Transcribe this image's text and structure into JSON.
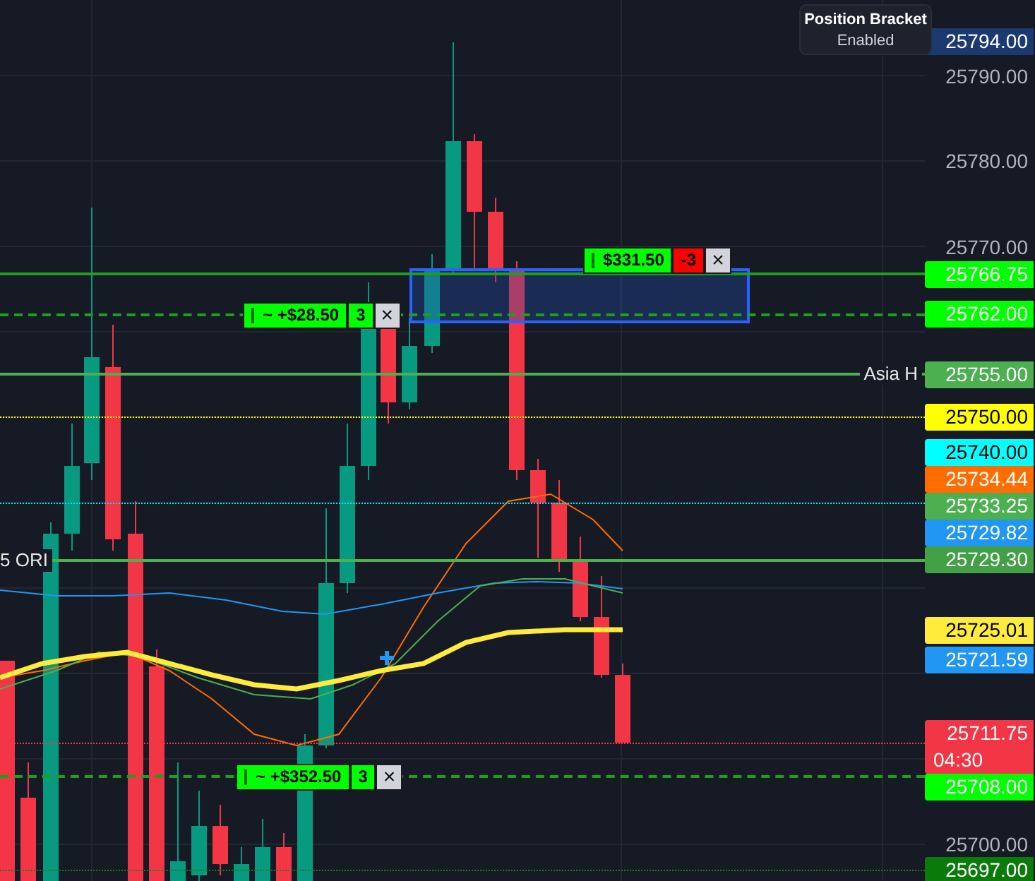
{
  "position_bracket": {
    "title": "Position Bracket",
    "status": "Enabled"
  },
  "price_axis": {
    "ticks": [
      "25790.00",
      "25780.00",
      "25770.00",
      "25700.00"
    ]
  },
  "price_tags": [
    {
      "label": "25794.00",
      "color": "#1c3a70"
    },
    {
      "label": "25766.75",
      "color": "#00ff00",
      "line": {
        "kind": "solid",
        "color": "#1e9e1e"
      },
      "order": {
        "pnl": "$331.50",
        "qty": "-3",
        "kind": "short",
        "close": "×"
      }
    },
    {
      "label": "25762.00",
      "color": "#00ff00",
      "line": {
        "kind": "dashed",
        "color": "#1e9e1e"
      },
      "order": {
        "pnl": "~ +$28.50",
        "qty": "3",
        "kind": "long",
        "close": "×"
      }
    },
    {
      "label": "25755.00",
      "color": "#4caf50",
      "line": {
        "kind": "solid",
        "color": "#4caf50",
        "right_text": "Asia H"
      }
    },
    {
      "label": "25750.00",
      "color": "#ffff00",
      "line": {
        "kind": "dotted",
        "color": "#ffff00"
      }
    },
    {
      "label": "25740.00",
      "color": "#00ffff",
      "line": {
        "kind": "dotted",
        "color": "#00e5ff"
      }
    },
    {
      "label": "25734.44",
      "color": "#ff6d00"
    },
    {
      "label": "25733.25",
      "color": "#4caf50",
      "line": {
        "kind": "solid",
        "color": "#4caf50",
        "left_text": "5 ORI"
      }
    },
    {
      "label": "25729.82",
      "color": "#2196f3"
    },
    {
      "label": "25729.30",
      "color": "#43a047"
    },
    {
      "label": "25725.01",
      "color": "#ffeb3b"
    },
    {
      "label": "25721.59",
      "color": "#2196f3"
    },
    {
      "label": "25711.75",
      "sublabel": "04:30",
      "color": "#f23645",
      "line": {
        "kind": "dotted",
        "color": "#f23645"
      }
    },
    {
      "label": "25708.00",
      "color": "#00ff00",
      "line": {
        "kind": "dashed",
        "color": "#1e9e1e"
      },
      "order": {
        "pnl": "~ +$352.50",
        "qty": "3",
        "kind": "long",
        "close": "×"
      }
    },
    {
      "label": "25697.00",
      "color": "#0a7a0a",
      "line": {
        "kind": "dotted",
        "color": "#1e7e1e"
      }
    }
  ]
}
